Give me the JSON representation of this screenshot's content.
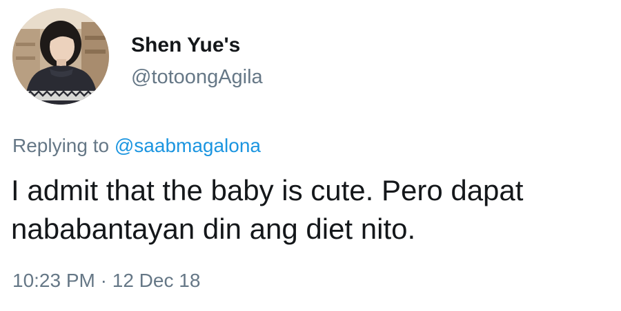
{
  "user": {
    "display_name": "Shen Yue's",
    "handle": "@totoongAgila"
  },
  "reply": {
    "prefix": "Replying to ",
    "mention": "@saabmagalona"
  },
  "tweet": {
    "lines": [
      "I admit that the baby is cute. Pero dapat",
      "nababantayan din ang diet nito."
    ]
  },
  "meta": {
    "time": "10:23 PM",
    "separator": " · ",
    "date": "12 Dec 18"
  },
  "colors": {
    "text_primary": "#14171a",
    "text_secondary": "#657786",
    "link": "#1b95e0"
  }
}
